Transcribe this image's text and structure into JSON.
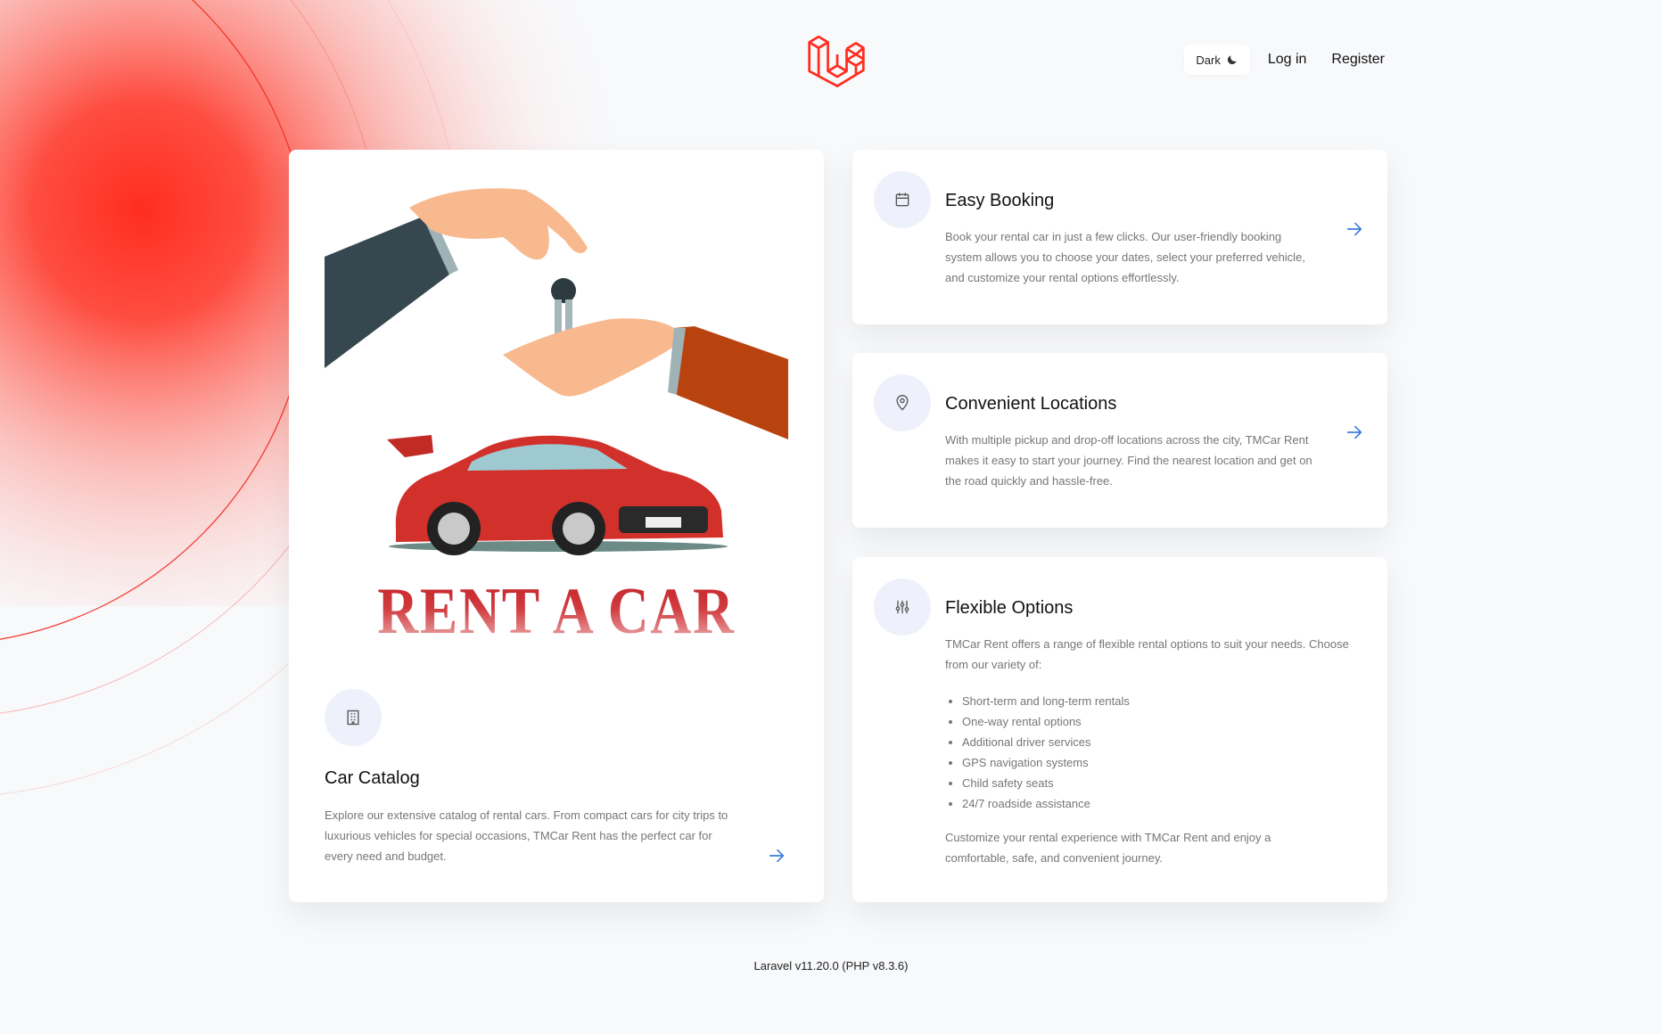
{
  "header": {
    "logo": "laravel-logo",
    "theme_toggle": {
      "label": "Dark",
      "icon": "moon-icon"
    },
    "login": "Log in",
    "register": "Register"
  },
  "catalog": {
    "image": {
      "title": "RENT A CAR",
      "description_icon": "car-keys-handover-illustration"
    },
    "icon": "building-icon",
    "title": "Car Catalog",
    "description": "Explore our extensive catalog of rental cars. From compact cars for city trips to luxurious vehicles for special occasions, TMCar Rent has the perfect car for every need and budget.",
    "arrow_icon": "arrow-right-icon"
  },
  "booking": {
    "icon": "calendar-icon",
    "title": "Easy Booking",
    "description": "Book your rental car in just a few clicks. Our user-friendly booking system allows you to choose your dates, select your preferred vehicle, and customize your rental options effortlessly.",
    "arrow_icon": "arrow-right-icon"
  },
  "locations": {
    "icon": "map-pin-icon",
    "title": "Convenient Locations",
    "description": "With multiple pickup and drop-off locations across the city, TMCar Rent makes it easy to start your journey. Find the nearest location and get on the road quickly and hassle-free.",
    "arrow_icon": "arrow-right-icon"
  },
  "options": {
    "icon": "sliders-icon",
    "title": "Flexible Options",
    "intro": "TMCar Rent offers a range of flexible rental options to suit your needs. Choose from our variety of:",
    "items": [
      "Short-term and long-term rentals",
      "One-way rental options",
      "Additional driver services",
      "GPS navigation systems",
      "Child safety seats",
      "24/7 roadside assistance"
    ],
    "outro": "Customize your rental experience with TMCar Rent and enjoy a comfortable, safe, and convenient journey."
  },
  "footer": {
    "version": "Laravel v11.20.0 (PHP v8.3.6)"
  },
  "colors": {
    "brand_red": "#ff2d20",
    "accent_blue": "#3b7ddd",
    "icon_bg": "#eef1fb",
    "text_muted": "#767676"
  }
}
